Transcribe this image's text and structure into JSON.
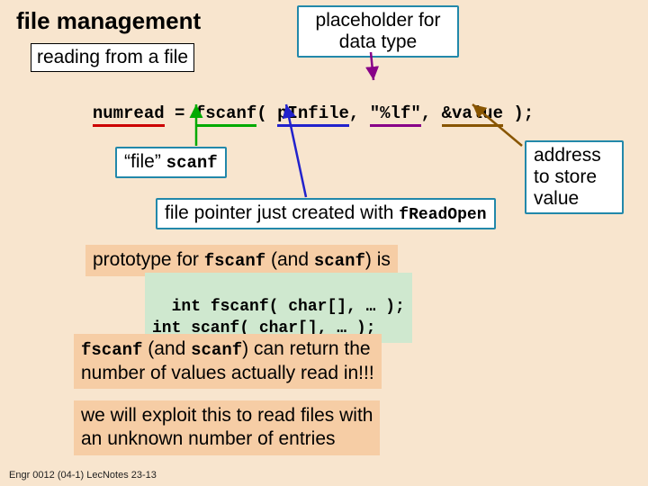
{
  "title": "file management",
  "subtitle": "reading from a file",
  "callout_placeholder_l1": "placeholder for",
  "callout_placeholder_l2": "data type",
  "code": {
    "numread": "numread",
    "eq": " = ",
    "fscanf": "fscanf",
    "open_p": "( ",
    "pInfile": "pInfile",
    "comma1": ", ",
    "fmt": "\"%lf\"",
    "comma2": ", ",
    "amp_value": "&value",
    "close": " );"
  },
  "callout_file_scanf_l1": "“file” ",
  "callout_file_scanf_l2": "scanf",
  "callout_fileptr_l1": "file pointer just created with ",
  "callout_fileptr_l2": "fReadOpen",
  "callout_address_l1": "address",
  "callout_address_l2": "to store",
  "callout_address_l3": "value",
  "proto_intro_pre": "prototype for ",
  "proto_intro_code1": "fscanf",
  "proto_intro_mid": " (and ",
  "proto_intro_code2": "scanf",
  "proto_intro_post": ") is",
  "proto_line1": "int fscanf( char[], … );",
  "proto_line2": "int scanf( char[], … );",
  "return_box_code1": "fscanf",
  "return_box_mid": " (and ",
  "return_box_code2": "scanf",
  "return_box_rest1": ") can return the",
  "return_box_rest2": "number of values actually read in!!!",
  "exploit_l1": "we will exploit this to read files with",
  "exploit_l2": "an unknown number of entries",
  "footer": "Engr 0012 (04-1) LecNotes 23-13"
}
